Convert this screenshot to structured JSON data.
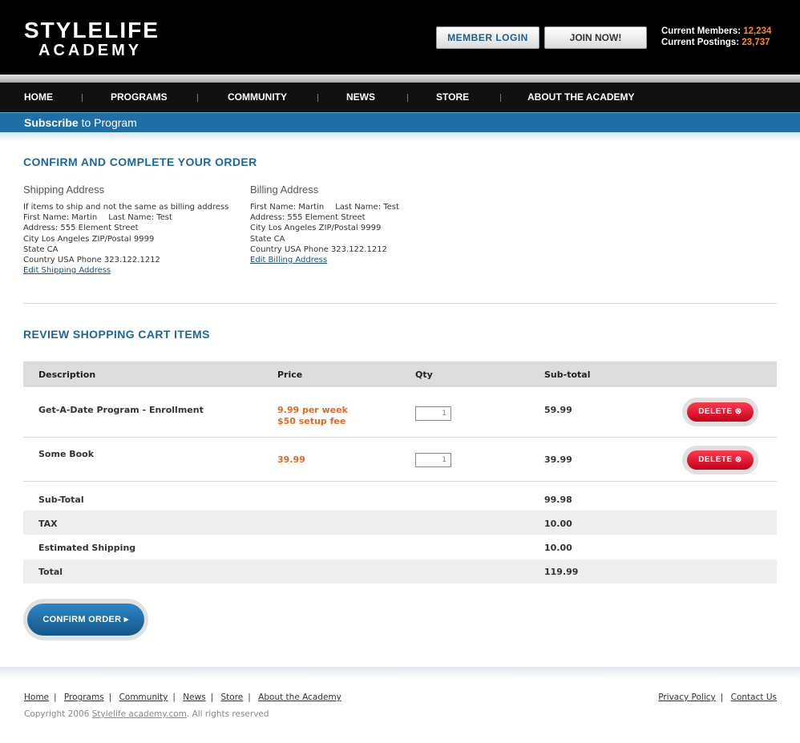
{
  "header": {
    "logo_line1": "STYLELIFE",
    "logo_line2": "ACADEMY",
    "login_label": "MEMBER  LOGIN",
    "join_label": "JOIN NOW!",
    "members_label": "Current Members:",
    "members_value": "12,234",
    "postings_label": "Current Postings:",
    "postings_value": "23,737"
  },
  "nav": {
    "items": [
      "HOME",
      "PROGRAMS",
      "COMMUNITY",
      "NEWS",
      "STORE",
      "ABOUT THE ACADEMY"
    ]
  },
  "subbar": {
    "bold": "Subscribe",
    "rest": " to Program"
  },
  "order": {
    "heading": "CONFIRM AND COMPLETE YOUR ORDER",
    "shipping": {
      "title": "Shipping Address",
      "note": "If items to ship and not the same as billing address",
      "first": "First Name: Martin",
      "last": "Last Name: Test",
      "address": "Address: 555 Element Street",
      "city": "City Los Angeles ZIP/Postal 9999",
      "state": "State CA",
      "country": "Country USA Phone 323.122.1212",
      "edit": "Edit Shipping Address"
    },
    "billing": {
      "title": "Billing Address",
      "first": "First Name: Martin",
      "last": "Last Name: Test",
      "address": "Address: 555 Element Street",
      "city": "City Los Angeles ZIP/Postal 9999",
      "state": "State CA",
      "country": "Country USA Phone 323.122.1212",
      "edit": "Edit Billing Address"
    }
  },
  "cart": {
    "heading": "REVIEW SHOPPING CART ITEMS",
    "columns": [
      "Description",
      "Price",
      "Qty",
      "Sub-total"
    ],
    "items": [
      {
        "description": "Get-A-Date Program - Enrollment",
        "price_line1": "9.99 per week",
        "price_line2": "$50 setup fee",
        "qty": "1",
        "subtotal": "59.99",
        "delete": "DELETE"
      },
      {
        "description": "Some Book",
        "price_line1": "39.99",
        "qty": "1",
        "subtotal": "39.99",
        "delete": "DELETE"
      }
    ],
    "totals": [
      {
        "label": "Sub-Total",
        "value": "99.98"
      },
      {
        "label": "TAX",
        "value": "10.00"
      },
      {
        "label": "Estimated Shipping",
        "value": "10.00"
      },
      {
        "label": "Total",
        "value": "119.99"
      }
    ],
    "confirm_label": "CONFIRM ORDER"
  },
  "footer": {
    "links": [
      "Home",
      "Programs",
      "Community",
      "News",
      "Store",
      "About the Academy"
    ],
    "right_links": [
      "Privacy Policy",
      "Contact Us"
    ],
    "copyright_prefix": "Copyright 2006 ",
    "copyright_link": "Stylelife academy.com",
    "copyright_suffix": ".  All rights reserved"
  },
  "colors": {
    "accent_blue": "#1b66a0",
    "orange": "#e8661b",
    "delete_red": "#d9001f"
  }
}
